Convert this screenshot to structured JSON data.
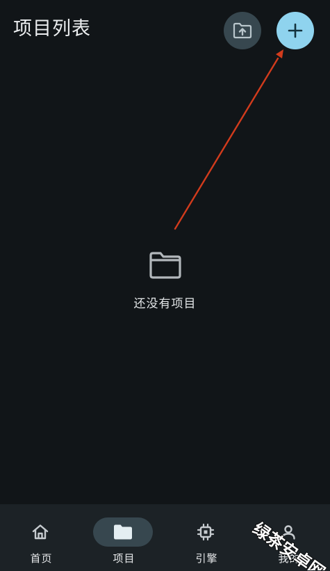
{
  "header": {
    "title": "项目列表",
    "import_icon": "folder-upload-icon",
    "add_icon": "plus-icon",
    "add_button_color": "#8fd3ee",
    "import_button_color": "#37474f"
  },
  "annotation": {
    "arrow_color": "#d23b1c"
  },
  "empty_state": {
    "icon": "folder-icon",
    "text": "还没有项目"
  },
  "bottom_nav": {
    "active": "项目",
    "items": [
      {
        "label": "首页",
        "icon": "home-icon"
      },
      {
        "label": "项目",
        "icon": "folder-icon"
      },
      {
        "label": "引擎",
        "icon": "chip-icon"
      },
      {
        "label": "我的",
        "icon": "user-icon"
      }
    ]
  },
  "watermark": {
    "text": "绿茶安卓网"
  }
}
